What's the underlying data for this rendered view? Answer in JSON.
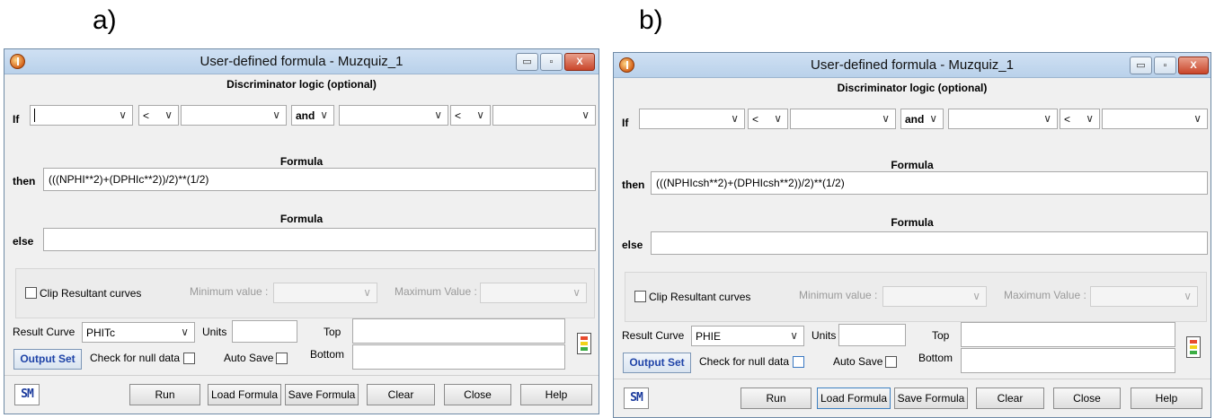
{
  "panels": [
    {
      "letter": "a)",
      "window_title": "User-defined formula  -  Muzquiz_1",
      "titlebar_buttons": {
        "minimize": "▭",
        "maximize": "▫",
        "close": "X"
      },
      "discriminator_heading": "Discriminator logic (optional)",
      "if_label": "If",
      "if_field_1": "",
      "operator_1": "<",
      "if_field_2": "",
      "conjunction": "and",
      "if_field_3": "",
      "operator_2": "<",
      "if_field_4": "",
      "formula_heading_1": "Formula",
      "then_label": "then",
      "then_formula": "(((NPHI**2)+(DPHIc**2))/2)**(1/2)",
      "formula_heading_2": "Formula",
      "else_label": "else",
      "else_formula": "",
      "clip_label": "Clip Resultant curves",
      "min_label": "Minimum value :",
      "max_label": "Maximum Value :",
      "result_curve_label": "Result Curve",
      "result_curve_value": "PHITc",
      "units_label": "Units",
      "units_value": "",
      "top_label": "Top",
      "bottom_label": "Bottom",
      "output_set_label": "Output Set",
      "null_data_label": "Check for null data",
      "auto_save_label": "Auto Save",
      "sm_logo": "SM",
      "buttons": {
        "run": "Run",
        "load": "Load Formula",
        "save": "Save Formula",
        "clear": "Clear",
        "close": "Close",
        "help": "Help"
      }
    },
    {
      "letter": "b)",
      "window_title": "User-defined formula  -  Muzquiz_1",
      "titlebar_buttons": {
        "minimize": "▭",
        "maximize": "▫",
        "close": "X"
      },
      "discriminator_heading": "Discriminator logic (optional)",
      "if_label": "If",
      "if_field_1": "",
      "operator_1": "<",
      "if_field_2": "",
      "conjunction": "and",
      "if_field_3": "",
      "operator_2": "<",
      "if_field_4": "",
      "formula_heading_1": "Formula",
      "then_label": "then",
      "then_formula": "(((NPHIcsh**2)+(DPHIcsh**2))/2)**(1/2)",
      "formula_heading_2": "Formula",
      "else_label": "else",
      "else_formula": "",
      "clip_label": "Clip Resultant curves",
      "min_label": "Minimum value :",
      "max_label": "Maximum Value :",
      "result_curve_label": "Result Curve",
      "result_curve_value": "PHIE",
      "units_label": "Units",
      "units_value": "",
      "top_label": "Top",
      "bottom_label": "Bottom",
      "output_set_label": "Output Set",
      "null_data_label": "Check for null data",
      "auto_save_label": "Auto Save",
      "sm_logo": "SM",
      "buttons": {
        "run": "Run",
        "load": "Load Formula",
        "save": "Save Formula",
        "clear": "Clear",
        "close": "Close",
        "help": "Help"
      }
    }
  ]
}
